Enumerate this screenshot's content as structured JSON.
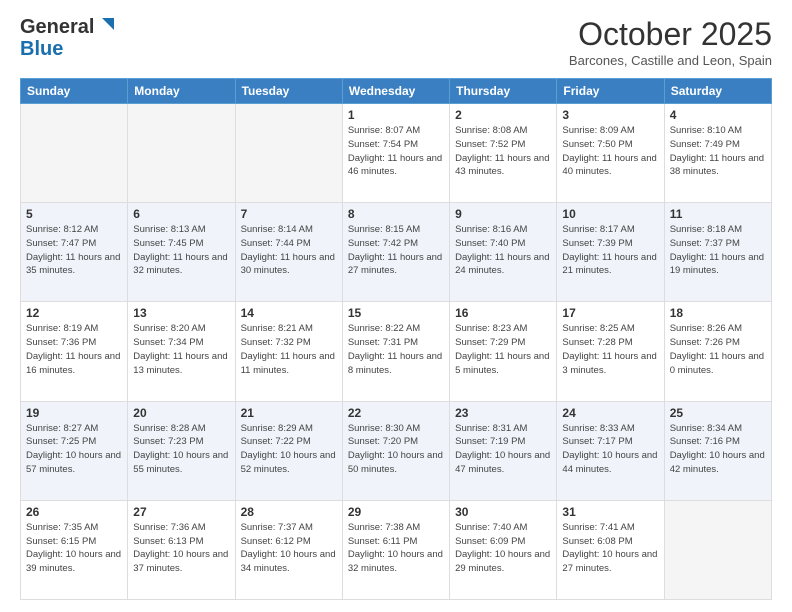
{
  "logo": {
    "line1": "General",
    "line2": "Blue"
  },
  "header": {
    "month": "October 2025",
    "location": "Barcones, Castille and Leon, Spain"
  },
  "weekdays": [
    "Sunday",
    "Monday",
    "Tuesday",
    "Wednesday",
    "Thursday",
    "Friday",
    "Saturday"
  ],
  "weeks": [
    [
      {
        "day": "",
        "sunrise": "",
        "sunset": "",
        "daylight": ""
      },
      {
        "day": "",
        "sunrise": "",
        "sunset": "",
        "daylight": ""
      },
      {
        "day": "",
        "sunrise": "",
        "sunset": "",
        "daylight": ""
      },
      {
        "day": "1",
        "sunrise": "Sunrise: 8:07 AM",
        "sunset": "Sunset: 7:54 PM",
        "daylight": "Daylight: 11 hours and 46 minutes."
      },
      {
        "day": "2",
        "sunrise": "Sunrise: 8:08 AM",
        "sunset": "Sunset: 7:52 PM",
        "daylight": "Daylight: 11 hours and 43 minutes."
      },
      {
        "day": "3",
        "sunrise": "Sunrise: 8:09 AM",
        "sunset": "Sunset: 7:50 PM",
        "daylight": "Daylight: 11 hours and 40 minutes."
      },
      {
        "day": "4",
        "sunrise": "Sunrise: 8:10 AM",
        "sunset": "Sunset: 7:49 PM",
        "daylight": "Daylight: 11 hours and 38 minutes."
      }
    ],
    [
      {
        "day": "5",
        "sunrise": "Sunrise: 8:12 AM",
        "sunset": "Sunset: 7:47 PM",
        "daylight": "Daylight: 11 hours and 35 minutes."
      },
      {
        "day": "6",
        "sunrise": "Sunrise: 8:13 AM",
        "sunset": "Sunset: 7:45 PM",
        "daylight": "Daylight: 11 hours and 32 minutes."
      },
      {
        "day": "7",
        "sunrise": "Sunrise: 8:14 AM",
        "sunset": "Sunset: 7:44 PM",
        "daylight": "Daylight: 11 hours and 30 minutes."
      },
      {
        "day": "8",
        "sunrise": "Sunrise: 8:15 AM",
        "sunset": "Sunset: 7:42 PM",
        "daylight": "Daylight: 11 hours and 27 minutes."
      },
      {
        "day": "9",
        "sunrise": "Sunrise: 8:16 AM",
        "sunset": "Sunset: 7:40 PM",
        "daylight": "Daylight: 11 hours and 24 minutes."
      },
      {
        "day": "10",
        "sunrise": "Sunrise: 8:17 AM",
        "sunset": "Sunset: 7:39 PM",
        "daylight": "Daylight: 11 hours and 21 minutes."
      },
      {
        "day": "11",
        "sunrise": "Sunrise: 8:18 AM",
        "sunset": "Sunset: 7:37 PM",
        "daylight": "Daylight: 11 hours and 19 minutes."
      }
    ],
    [
      {
        "day": "12",
        "sunrise": "Sunrise: 8:19 AM",
        "sunset": "Sunset: 7:36 PM",
        "daylight": "Daylight: 11 hours and 16 minutes."
      },
      {
        "day": "13",
        "sunrise": "Sunrise: 8:20 AM",
        "sunset": "Sunset: 7:34 PM",
        "daylight": "Daylight: 11 hours and 13 minutes."
      },
      {
        "day": "14",
        "sunrise": "Sunrise: 8:21 AM",
        "sunset": "Sunset: 7:32 PM",
        "daylight": "Daylight: 11 hours and 11 minutes."
      },
      {
        "day": "15",
        "sunrise": "Sunrise: 8:22 AM",
        "sunset": "Sunset: 7:31 PM",
        "daylight": "Daylight: 11 hours and 8 minutes."
      },
      {
        "day": "16",
        "sunrise": "Sunrise: 8:23 AM",
        "sunset": "Sunset: 7:29 PM",
        "daylight": "Daylight: 11 hours and 5 minutes."
      },
      {
        "day": "17",
        "sunrise": "Sunrise: 8:25 AM",
        "sunset": "Sunset: 7:28 PM",
        "daylight": "Daylight: 11 hours and 3 minutes."
      },
      {
        "day": "18",
        "sunrise": "Sunrise: 8:26 AM",
        "sunset": "Sunset: 7:26 PM",
        "daylight": "Daylight: 11 hours and 0 minutes."
      }
    ],
    [
      {
        "day": "19",
        "sunrise": "Sunrise: 8:27 AM",
        "sunset": "Sunset: 7:25 PM",
        "daylight": "Daylight: 10 hours and 57 minutes."
      },
      {
        "day": "20",
        "sunrise": "Sunrise: 8:28 AM",
        "sunset": "Sunset: 7:23 PM",
        "daylight": "Daylight: 10 hours and 55 minutes."
      },
      {
        "day": "21",
        "sunrise": "Sunrise: 8:29 AM",
        "sunset": "Sunset: 7:22 PM",
        "daylight": "Daylight: 10 hours and 52 minutes."
      },
      {
        "day": "22",
        "sunrise": "Sunrise: 8:30 AM",
        "sunset": "Sunset: 7:20 PM",
        "daylight": "Daylight: 10 hours and 50 minutes."
      },
      {
        "day": "23",
        "sunrise": "Sunrise: 8:31 AM",
        "sunset": "Sunset: 7:19 PM",
        "daylight": "Daylight: 10 hours and 47 minutes."
      },
      {
        "day": "24",
        "sunrise": "Sunrise: 8:33 AM",
        "sunset": "Sunset: 7:17 PM",
        "daylight": "Daylight: 10 hours and 44 minutes."
      },
      {
        "day": "25",
        "sunrise": "Sunrise: 8:34 AM",
        "sunset": "Sunset: 7:16 PM",
        "daylight": "Daylight: 10 hours and 42 minutes."
      }
    ],
    [
      {
        "day": "26",
        "sunrise": "Sunrise: 7:35 AM",
        "sunset": "Sunset: 6:15 PM",
        "daylight": "Daylight: 10 hours and 39 minutes."
      },
      {
        "day": "27",
        "sunrise": "Sunrise: 7:36 AM",
        "sunset": "Sunset: 6:13 PM",
        "daylight": "Daylight: 10 hours and 37 minutes."
      },
      {
        "day": "28",
        "sunrise": "Sunrise: 7:37 AM",
        "sunset": "Sunset: 6:12 PM",
        "daylight": "Daylight: 10 hours and 34 minutes."
      },
      {
        "day": "29",
        "sunrise": "Sunrise: 7:38 AM",
        "sunset": "Sunset: 6:11 PM",
        "daylight": "Daylight: 10 hours and 32 minutes."
      },
      {
        "day": "30",
        "sunrise": "Sunrise: 7:40 AM",
        "sunset": "Sunset: 6:09 PM",
        "daylight": "Daylight: 10 hours and 29 minutes."
      },
      {
        "day": "31",
        "sunrise": "Sunrise: 7:41 AM",
        "sunset": "Sunset: 6:08 PM",
        "daylight": "Daylight: 10 hours and 27 minutes."
      },
      {
        "day": "",
        "sunrise": "",
        "sunset": "",
        "daylight": ""
      }
    ]
  ]
}
